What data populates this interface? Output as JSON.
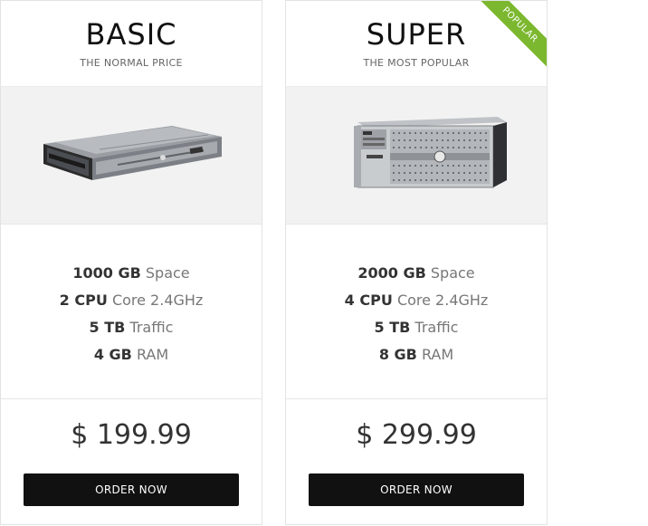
{
  "plans": [
    {
      "title": "BASIC",
      "subtitle": "THE NORMAL PRICE",
      "image_icon": "rack-server-1u-icon",
      "features": [
        {
          "value": "1000 GB",
          "label": "Space"
        },
        {
          "value": "2 CPU",
          "label": "Core 2.4GHz"
        },
        {
          "value": "5 TB",
          "label": "Traffic"
        },
        {
          "value": "4 GB",
          "label": "RAM"
        }
      ],
      "price": "$ 199.99",
      "order_label": "ORDER NOW"
    },
    {
      "title": "SUPER",
      "subtitle": "THE MOST POPULAR",
      "badge": "POPULAR",
      "badge_color": "#7cb82f",
      "image_icon": "rack-server-4u-icon",
      "features": [
        {
          "value": "2000 GB",
          "label": "Space"
        },
        {
          "value": "4 CPU",
          "label": "Core 2.4GHz"
        },
        {
          "value": "5 TB",
          "label": "Traffic"
        },
        {
          "value": "8 GB",
          "label": "RAM"
        }
      ],
      "price": "$ 299.99",
      "order_label": "ORDER NOW"
    }
  ]
}
